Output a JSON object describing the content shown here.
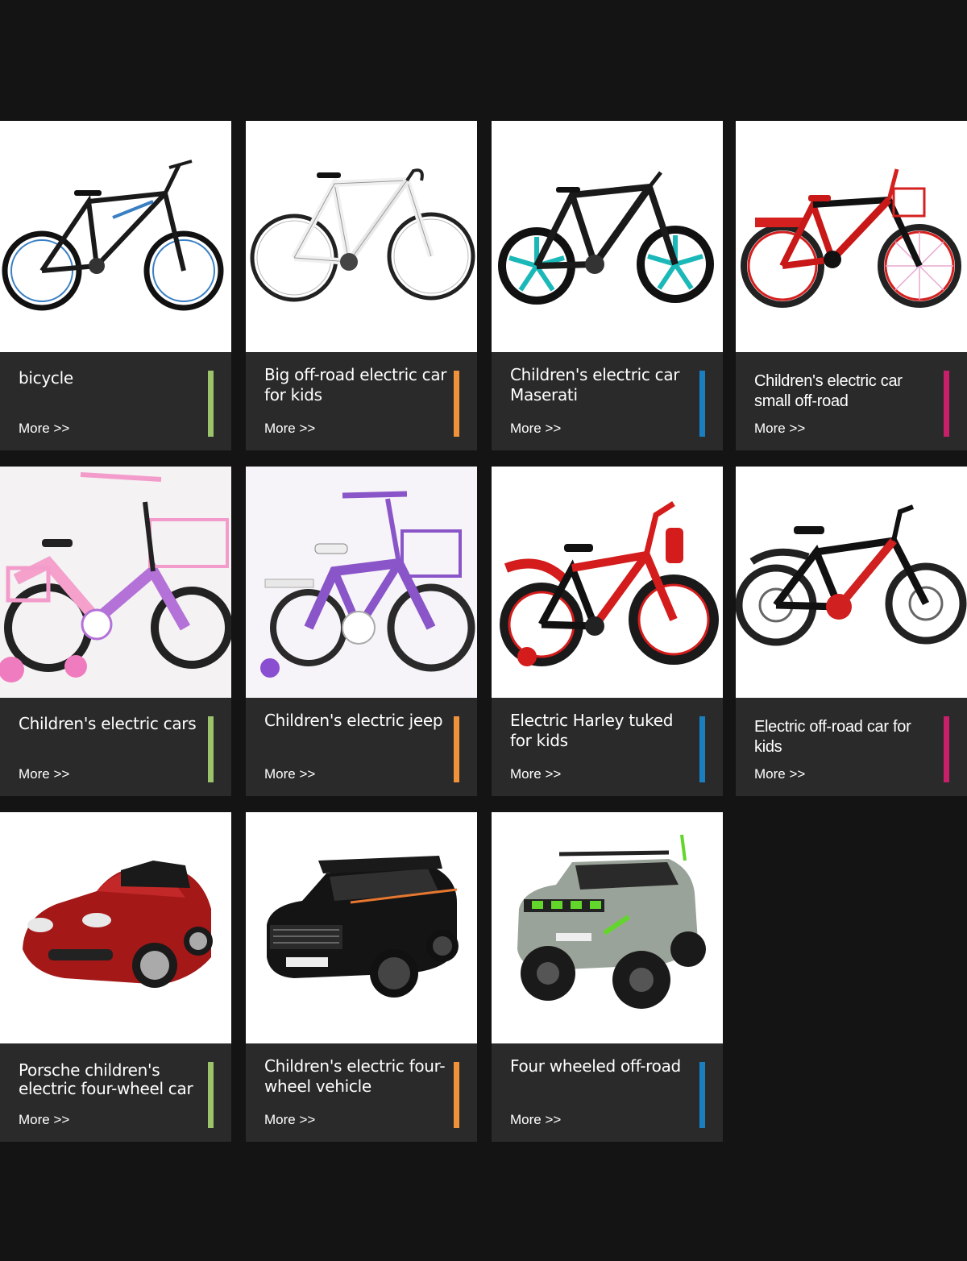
{
  "products": [
    {
      "title": "bicycle",
      "more": "More >>",
      "accent": "#9bc36b",
      "image": "black-blue-mountain-bicycle"
    },
    {
      "title": "Big off-road electric car for kids",
      "more": "More >>",
      "accent": "#f0923a",
      "image": "white-road-bicycle"
    },
    {
      "title": "Children's electric car Maserati",
      "more": "More >>",
      "accent": "#1a7fc1",
      "image": "black-teal-mountain-bicycle"
    },
    {
      "title": "Children's electric car small off-road",
      "more": "More >>",
      "accent": "#c81f6a",
      "image": "red-kids-bicycle"
    },
    {
      "title": "Children's electric cars",
      "more": "More >>",
      "accent": "#9bc36b",
      "image": "pink-kids-bicycle"
    },
    {
      "title": "Children's electric jeep",
      "more": "More >>",
      "accent": "#f0923a",
      "image": "purple-kids-bicycle"
    },
    {
      "title": "Electric Harley tuked for kids",
      "more": "More >>",
      "accent": "#1a7fc1",
      "image": "red-black-kids-bicycle"
    },
    {
      "title": "Electric off-road car for kids",
      "more": "More >>",
      "accent": "#c81f6a",
      "image": "black-red-bmx-bicycle"
    },
    {
      "title": "Porsche children's electric four-wheel car",
      "more": "More >>",
      "accent": "#9bc36b",
      "image": "red-ride-on-sports-car"
    },
    {
      "title": "Children's electric four-wheel vehicle",
      "more": "More >>",
      "accent": "#f0923a",
      "image": "black-ride-on-suv"
    },
    {
      "title": "Four wheeled off-road",
      "more": "More >>",
      "accent": "#1a7fc1",
      "image": "green-ride-on-jeep"
    }
  ]
}
